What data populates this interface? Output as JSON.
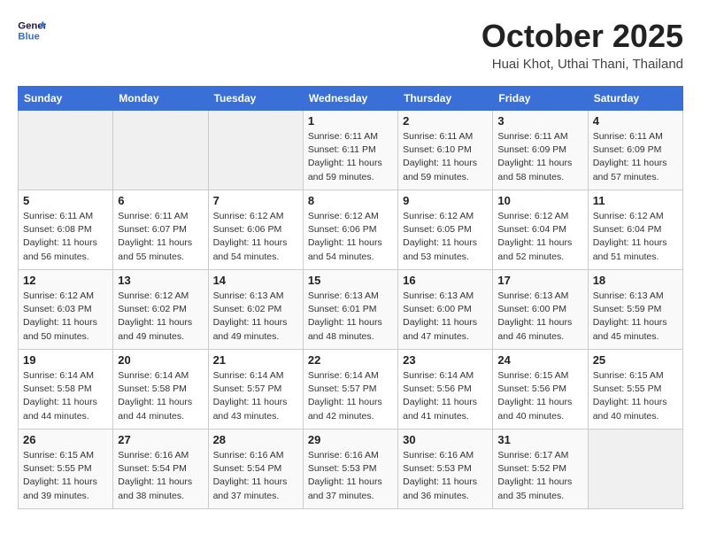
{
  "header": {
    "logo_line1": "General",
    "logo_line2": "Blue",
    "month": "October 2025",
    "location": "Huai Khot, Uthai Thani, Thailand"
  },
  "weekdays": [
    "Sunday",
    "Monday",
    "Tuesday",
    "Wednesday",
    "Thursday",
    "Friday",
    "Saturday"
  ],
  "weeks": [
    [
      {
        "day": "",
        "info": ""
      },
      {
        "day": "",
        "info": ""
      },
      {
        "day": "",
        "info": ""
      },
      {
        "day": "1",
        "info": "Sunrise: 6:11 AM\nSunset: 6:11 PM\nDaylight: 11 hours\nand 59 minutes."
      },
      {
        "day": "2",
        "info": "Sunrise: 6:11 AM\nSunset: 6:10 PM\nDaylight: 11 hours\nand 59 minutes."
      },
      {
        "day": "3",
        "info": "Sunrise: 6:11 AM\nSunset: 6:09 PM\nDaylight: 11 hours\nand 58 minutes."
      },
      {
        "day": "4",
        "info": "Sunrise: 6:11 AM\nSunset: 6:09 PM\nDaylight: 11 hours\nand 57 minutes."
      }
    ],
    [
      {
        "day": "5",
        "info": "Sunrise: 6:11 AM\nSunset: 6:08 PM\nDaylight: 11 hours\nand 56 minutes."
      },
      {
        "day": "6",
        "info": "Sunrise: 6:11 AM\nSunset: 6:07 PM\nDaylight: 11 hours\nand 55 minutes."
      },
      {
        "day": "7",
        "info": "Sunrise: 6:12 AM\nSunset: 6:06 PM\nDaylight: 11 hours\nand 54 minutes."
      },
      {
        "day": "8",
        "info": "Sunrise: 6:12 AM\nSunset: 6:06 PM\nDaylight: 11 hours\nand 54 minutes."
      },
      {
        "day": "9",
        "info": "Sunrise: 6:12 AM\nSunset: 6:05 PM\nDaylight: 11 hours\nand 53 minutes."
      },
      {
        "day": "10",
        "info": "Sunrise: 6:12 AM\nSunset: 6:04 PM\nDaylight: 11 hours\nand 52 minutes."
      },
      {
        "day": "11",
        "info": "Sunrise: 6:12 AM\nSunset: 6:04 PM\nDaylight: 11 hours\nand 51 minutes."
      }
    ],
    [
      {
        "day": "12",
        "info": "Sunrise: 6:12 AM\nSunset: 6:03 PM\nDaylight: 11 hours\nand 50 minutes."
      },
      {
        "day": "13",
        "info": "Sunrise: 6:12 AM\nSunset: 6:02 PM\nDaylight: 11 hours\nand 49 minutes."
      },
      {
        "day": "14",
        "info": "Sunrise: 6:13 AM\nSunset: 6:02 PM\nDaylight: 11 hours\nand 49 minutes."
      },
      {
        "day": "15",
        "info": "Sunrise: 6:13 AM\nSunset: 6:01 PM\nDaylight: 11 hours\nand 48 minutes."
      },
      {
        "day": "16",
        "info": "Sunrise: 6:13 AM\nSunset: 6:00 PM\nDaylight: 11 hours\nand 47 minutes."
      },
      {
        "day": "17",
        "info": "Sunrise: 6:13 AM\nSunset: 6:00 PM\nDaylight: 11 hours\nand 46 minutes."
      },
      {
        "day": "18",
        "info": "Sunrise: 6:13 AM\nSunset: 5:59 PM\nDaylight: 11 hours\nand 45 minutes."
      }
    ],
    [
      {
        "day": "19",
        "info": "Sunrise: 6:14 AM\nSunset: 5:58 PM\nDaylight: 11 hours\nand 44 minutes."
      },
      {
        "day": "20",
        "info": "Sunrise: 6:14 AM\nSunset: 5:58 PM\nDaylight: 11 hours\nand 44 minutes."
      },
      {
        "day": "21",
        "info": "Sunrise: 6:14 AM\nSunset: 5:57 PM\nDaylight: 11 hours\nand 43 minutes."
      },
      {
        "day": "22",
        "info": "Sunrise: 6:14 AM\nSunset: 5:57 PM\nDaylight: 11 hours\nand 42 minutes."
      },
      {
        "day": "23",
        "info": "Sunrise: 6:14 AM\nSunset: 5:56 PM\nDaylight: 11 hours\nand 41 minutes."
      },
      {
        "day": "24",
        "info": "Sunrise: 6:15 AM\nSunset: 5:56 PM\nDaylight: 11 hours\nand 40 minutes."
      },
      {
        "day": "25",
        "info": "Sunrise: 6:15 AM\nSunset: 5:55 PM\nDaylight: 11 hours\nand 40 minutes."
      }
    ],
    [
      {
        "day": "26",
        "info": "Sunrise: 6:15 AM\nSunset: 5:55 PM\nDaylight: 11 hours\nand 39 minutes."
      },
      {
        "day": "27",
        "info": "Sunrise: 6:16 AM\nSunset: 5:54 PM\nDaylight: 11 hours\nand 38 minutes."
      },
      {
        "day": "28",
        "info": "Sunrise: 6:16 AM\nSunset: 5:54 PM\nDaylight: 11 hours\nand 37 minutes."
      },
      {
        "day": "29",
        "info": "Sunrise: 6:16 AM\nSunset: 5:53 PM\nDaylight: 11 hours\nand 37 minutes."
      },
      {
        "day": "30",
        "info": "Sunrise: 6:16 AM\nSunset: 5:53 PM\nDaylight: 11 hours\nand 36 minutes."
      },
      {
        "day": "31",
        "info": "Sunrise: 6:17 AM\nSunset: 5:52 PM\nDaylight: 11 hours\nand 35 minutes."
      },
      {
        "day": "",
        "info": ""
      }
    ]
  ]
}
